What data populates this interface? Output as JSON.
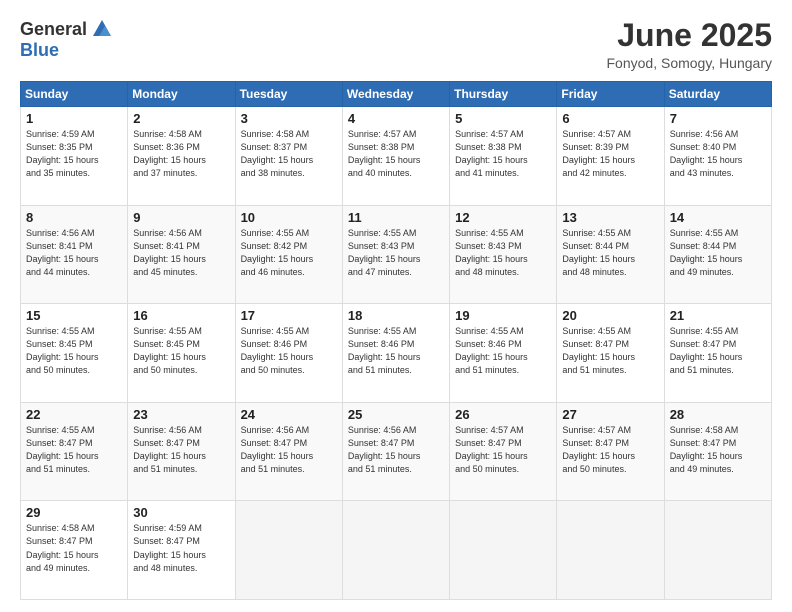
{
  "header": {
    "logo_general": "General",
    "logo_blue": "Blue",
    "month_title": "June 2025",
    "location": "Fonyod, Somogy, Hungary"
  },
  "weekdays": [
    "Sunday",
    "Monday",
    "Tuesday",
    "Wednesday",
    "Thursday",
    "Friday",
    "Saturday"
  ],
  "weeks": [
    [
      {
        "day": "1",
        "rise": "4:59 AM",
        "set": "8:35 PM",
        "light": "15 hours and 35 minutes."
      },
      {
        "day": "2",
        "rise": "4:58 AM",
        "set": "8:36 PM",
        "light": "15 hours and 37 minutes."
      },
      {
        "day": "3",
        "rise": "4:58 AM",
        "set": "8:37 PM",
        "light": "15 hours and 38 minutes."
      },
      {
        "day": "4",
        "rise": "4:57 AM",
        "set": "8:38 PM",
        "light": "15 hours and 40 minutes."
      },
      {
        "day": "5",
        "rise": "4:57 AM",
        "set": "8:38 PM",
        "light": "15 hours and 41 minutes."
      },
      {
        "day": "6",
        "rise": "4:57 AM",
        "set": "8:39 PM",
        "light": "15 hours and 42 minutes."
      },
      {
        "day": "7",
        "rise": "4:56 AM",
        "set": "8:40 PM",
        "light": "15 hours and 43 minutes."
      }
    ],
    [
      {
        "day": "8",
        "rise": "4:56 AM",
        "set": "8:41 PM",
        "light": "15 hours and 44 minutes."
      },
      {
        "day": "9",
        "rise": "4:56 AM",
        "set": "8:41 PM",
        "light": "15 hours and 45 minutes."
      },
      {
        "day": "10",
        "rise": "4:55 AM",
        "set": "8:42 PM",
        "light": "15 hours and 46 minutes."
      },
      {
        "day": "11",
        "rise": "4:55 AM",
        "set": "8:43 PM",
        "light": "15 hours and 47 minutes."
      },
      {
        "day": "12",
        "rise": "4:55 AM",
        "set": "8:43 PM",
        "light": "15 hours and 48 minutes."
      },
      {
        "day": "13",
        "rise": "4:55 AM",
        "set": "8:44 PM",
        "light": "15 hours and 48 minutes."
      },
      {
        "day": "14",
        "rise": "4:55 AM",
        "set": "8:44 PM",
        "light": "15 hours and 49 minutes."
      }
    ],
    [
      {
        "day": "15",
        "rise": "4:55 AM",
        "set": "8:45 PM",
        "light": "15 hours and 50 minutes."
      },
      {
        "day": "16",
        "rise": "4:55 AM",
        "set": "8:45 PM",
        "light": "15 hours and 50 minutes."
      },
      {
        "day": "17",
        "rise": "4:55 AM",
        "set": "8:46 PM",
        "light": "15 hours and 50 minutes."
      },
      {
        "day": "18",
        "rise": "4:55 AM",
        "set": "8:46 PM",
        "light": "15 hours and 51 minutes."
      },
      {
        "day": "19",
        "rise": "4:55 AM",
        "set": "8:46 PM",
        "light": "15 hours and 51 minutes."
      },
      {
        "day": "20",
        "rise": "4:55 AM",
        "set": "8:47 PM",
        "light": "15 hours and 51 minutes."
      },
      {
        "day": "21",
        "rise": "4:55 AM",
        "set": "8:47 PM",
        "light": "15 hours and 51 minutes."
      }
    ],
    [
      {
        "day": "22",
        "rise": "4:55 AM",
        "set": "8:47 PM",
        "light": "15 hours and 51 minutes."
      },
      {
        "day": "23",
        "rise": "4:56 AM",
        "set": "8:47 PM",
        "light": "15 hours and 51 minutes."
      },
      {
        "day": "24",
        "rise": "4:56 AM",
        "set": "8:47 PM",
        "light": "15 hours and 51 minutes."
      },
      {
        "day": "25",
        "rise": "4:56 AM",
        "set": "8:47 PM",
        "light": "15 hours and 51 minutes."
      },
      {
        "day": "26",
        "rise": "4:57 AM",
        "set": "8:47 PM",
        "light": "15 hours and 50 minutes."
      },
      {
        "day": "27",
        "rise": "4:57 AM",
        "set": "8:47 PM",
        "light": "15 hours and 50 minutes."
      },
      {
        "day": "28",
        "rise": "4:58 AM",
        "set": "8:47 PM",
        "light": "15 hours and 49 minutes."
      }
    ],
    [
      {
        "day": "29",
        "rise": "4:58 AM",
        "set": "8:47 PM",
        "light": "15 hours and 49 minutes."
      },
      {
        "day": "30",
        "rise": "4:59 AM",
        "set": "8:47 PM",
        "light": "15 hours and 48 minutes."
      },
      null,
      null,
      null,
      null,
      null
    ]
  ]
}
